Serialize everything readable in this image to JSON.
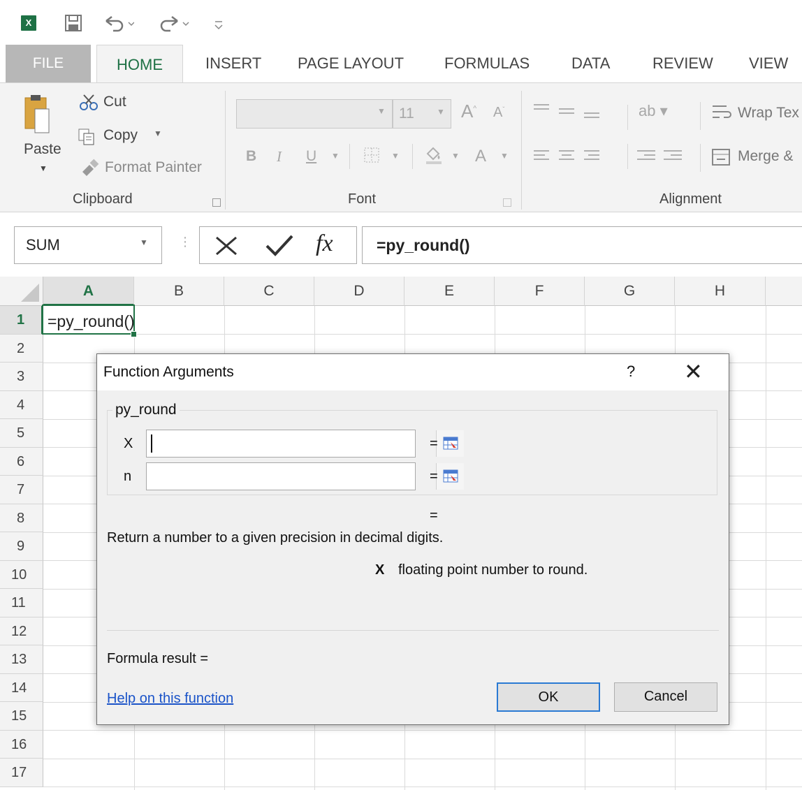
{
  "quick_access": {
    "logo": "X",
    "icons": [
      "save-icon",
      "undo-icon",
      "redo-icon",
      "customize-icon"
    ]
  },
  "tabs": {
    "file": "FILE",
    "home": "HOME",
    "insert": "INSERT",
    "page_layout": "PAGE LAYOUT",
    "formulas": "FORMULAS",
    "data": "DATA",
    "review": "REVIEW",
    "view": "VIEW"
  },
  "ribbon": {
    "clipboard": {
      "paste": "Paste",
      "cut": "Cut",
      "copy": "Copy",
      "format_painter": "Format Painter",
      "label": "Clipboard"
    },
    "font": {
      "font_name": "",
      "font_size": "11",
      "label": "Font",
      "bold": "B",
      "italic": "I",
      "underline": "U"
    },
    "alignment": {
      "wrap_text": "Wrap Tex",
      "merge": "Merge &",
      "label": "Alignment"
    }
  },
  "formula_bar": {
    "name_box": "SUM",
    "fx": "fx",
    "formula": "=py_round()"
  },
  "grid": {
    "columns": [
      "A",
      "B",
      "C",
      "D",
      "E",
      "F",
      "G",
      "H"
    ],
    "rows": [
      "1",
      "2",
      "3",
      "4",
      "5",
      "6",
      "7",
      "8",
      "9",
      "10",
      "11",
      "12",
      "13",
      "14",
      "15",
      "16",
      "17"
    ],
    "active_cell_text": "=py_round()"
  },
  "dialog": {
    "title": "Function Arguments",
    "help": "?",
    "close": "✕",
    "function_name": "py_round",
    "arg1_label": "X",
    "arg1_value": "",
    "arg2_label": "n",
    "arg2_value": "",
    "equals": "=",
    "description": "Return a number to a given precision in decimal digits.",
    "arg_desc_name": "X",
    "arg_desc_text": "floating point number to round.",
    "formula_result": "Formula result =",
    "help_link": "Help on this function",
    "ok": "OK",
    "cancel": "Cancel"
  },
  "colors": {
    "excel_green": "#217346",
    "ok_border": "#2a7ad3",
    "link": "#1a53c8"
  }
}
